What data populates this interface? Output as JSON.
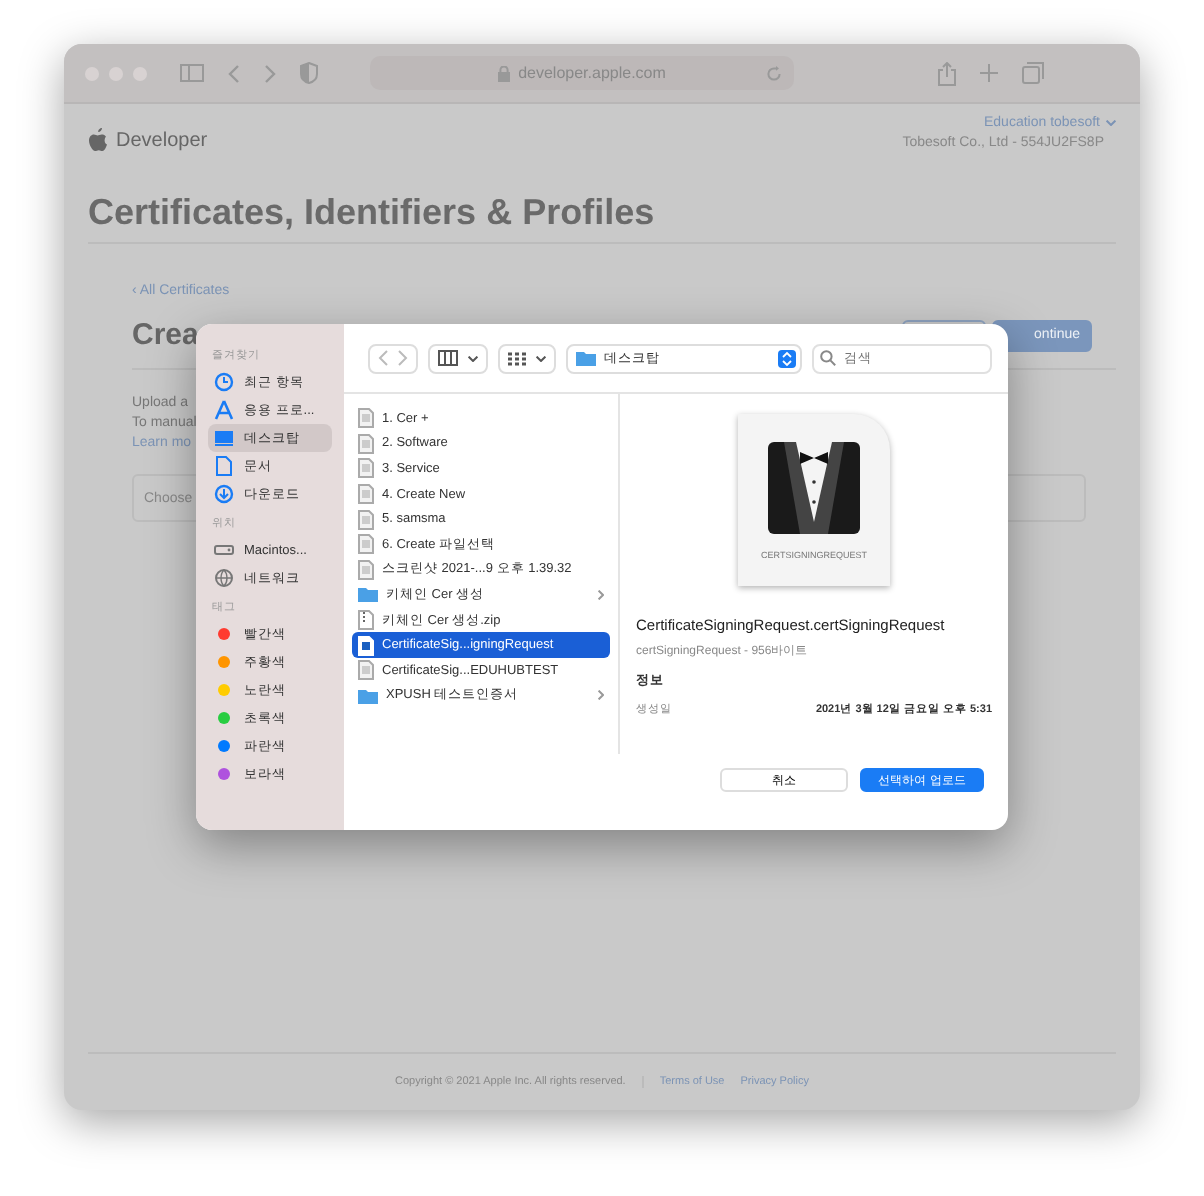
{
  "browser": {
    "address": "developer.apple.com"
  },
  "header": {
    "brand": "Developer",
    "account": "Education tobesoft",
    "team": "Tobesoft Co., Ltd - 554JU2FS8P"
  },
  "page": {
    "title": "Certificates, Identifiers & Profiles",
    "back_link": "‹ All Certificates",
    "heading": "Crea",
    "body_lines": [
      "Upload a",
      "To manual",
      "Learn mo"
    ],
    "choose_file": "Choose",
    "buttons": [
      {
        "kind": "secondary"
      },
      {
        "kind": "primary",
        "label": "ontinue"
      }
    ]
  },
  "footer": {
    "copyright": "Copyright © 2021 Apple Inc. All rights reserved.",
    "links": [
      "Terms of Use",
      "Privacy Policy"
    ]
  },
  "dialog": {
    "sidebar": [
      {
        "title": "즐겨찾기",
        "items": [
          {
            "label": "최근 항목",
            "kind": "recent",
            "selected": false
          },
          {
            "label": "응용 프로...",
            "kind": "apps",
            "selected": false
          },
          {
            "label": "데스크탑",
            "kind": "desktop",
            "selected": true
          },
          {
            "label": "문서",
            "kind": "document",
            "selected": false
          },
          {
            "label": "다운로드",
            "kind": "download",
            "selected": false
          }
        ]
      },
      {
        "title": "위치",
        "items": [
          {
            "label": "Macintos...",
            "kind": "disk",
            "selected": false
          },
          {
            "label": "네트워크",
            "kind": "network",
            "selected": false
          }
        ]
      },
      {
        "title": "태그",
        "items": [
          {
            "label": "빨간색",
            "kind": "tag",
            "color": "#ff3b30",
            "selected": false
          },
          {
            "label": "주황색",
            "kind": "tag",
            "color": "#ff9500",
            "selected": false
          },
          {
            "label": "노란색",
            "kind": "tag",
            "color": "#ffcc00",
            "selected": false
          },
          {
            "label": "초록색",
            "kind": "tag",
            "color": "#28cd41",
            "selected": false
          },
          {
            "label": "파란색",
            "kind": "tag",
            "color": "#007aff",
            "selected": false
          },
          {
            "label": "보라색",
            "kind": "tag",
            "color": "#af52de",
            "selected": false
          }
        ]
      }
    ],
    "location": "데스크탑",
    "search": {
      "placeholder": "검색"
    },
    "files": [
      {
        "name": "1. Cer +",
        "kind": "file",
        "selected": false
      },
      {
        "name": "2. Software",
        "kind": "file",
        "selected": false
      },
      {
        "name": "3. Service",
        "kind": "file",
        "selected": false
      },
      {
        "name": "4. Create New",
        "kind": "file",
        "selected": false
      },
      {
        "name": "5. samsma",
        "kind": "file",
        "selected": false
      },
      {
        "name": "6. Create 파일선택",
        "kind": "file",
        "selected": false
      },
      {
        "name": "스크린샷 2021-...9 오후 1.39.32",
        "kind": "file",
        "selected": false
      },
      {
        "name": "키체인 Cer 생성",
        "kind": "folder",
        "selected": false
      },
      {
        "name": "키체인 Cer 생성.zip",
        "kind": "zip",
        "selected": false
      },
      {
        "name": "CertificateSig...igningRequest",
        "kind": "file",
        "selected": true
      },
      {
        "name": "CertificateSig...EDUHUBTEST",
        "kind": "file",
        "selected": false
      },
      {
        "name": "XPUSH 테스트인증서",
        "kind": "folder",
        "selected": false
      }
    ],
    "preview": {
      "thumbnail_label": "CERTSIGNINGREQUEST",
      "name": "CertificateSigningRequest.certSigningRequest",
      "meta": "certSigningRequest - 956바이트",
      "info_title": "정보",
      "rows": [
        {
          "label": "생성일",
          "value": "2021년 3월 12일 금요일 오후 5:31"
        }
      ]
    },
    "cancel": "취소",
    "confirm": "선택하여 업로드"
  }
}
